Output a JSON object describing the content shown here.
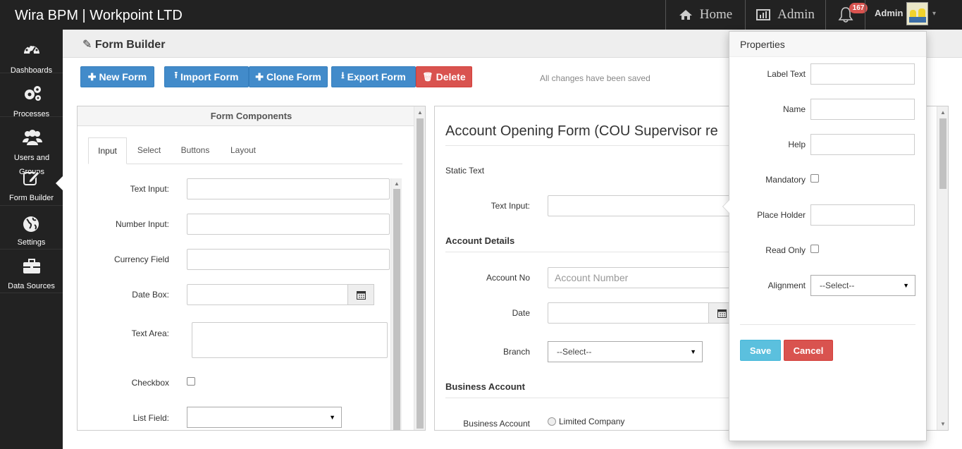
{
  "app": {
    "title": "Wira BPM | Workpoint LTD",
    "nav": {
      "home": "Home",
      "admin": "Admin",
      "notifications_count": "167",
      "user": "Admin"
    }
  },
  "sidebar": {
    "items": [
      {
        "label": "Dashboards",
        "icon": "dashboard-icon"
      },
      {
        "label": "Processes",
        "icon": "gears-icon"
      },
      {
        "label": "Users and Groups",
        "icon": "users-icon"
      },
      {
        "label": "Form Builder",
        "icon": "edit-icon"
      },
      {
        "label": "Settings",
        "icon": "globe-icon"
      },
      {
        "label": "Data Sources",
        "icon": "briefcase-icon"
      }
    ]
  },
  "page": {
    "title": "Form Builder",
    "status": "All changes have been saved"
  },
  "toolbar": {
    "new_form": "New Form",
    "import_form": "Import Form",
    "clone_form": "Clone Form",
    "export_form": "Export Form",
    "delete": "Delete"
  },
  "components_panel": {
    "title": "Form Components",
    "tabs": [
      "Input",
      "Select",
      "Buttons",
      "Layout"
    ],
    "active_tab": "Input",
    "fields": {
      "text_input": "Text Input:",
      "number_input": "Number Input:",
      "currency_field": "Currency Field",
      "date_box": "Date Box:",
      "text_area": "Text Area:",
      "checkbox": "Checkbox",
      "list_field": "List Field:"
    }
  },
  "form_canvas": {
    "title": "Account Opening Form (COU Supervisor re",
    "static_text": "Static Text",
    "text_input_label": "Text Input:",
    "section_account": "Account Details",
    "account_no_label": "Account No",
    "account_no_placeholder": "Account Number",
    "date_label": "Date",
    "branch_label": "Branch",
    "branch_value": "--Select--",
    "section_business": "Business Account",
    "business_account_label": "Business Account",
    "business_option": "Limited Company"
  },
  "properties": {
    "title": "Properties",
    "label_text": "Label Text",
    "name": "Name",
    "help": "Help",
    "mandatory": "Mandatory",
    "place_holder": "Place Holder",
    "read_only": "Read Only",
    "alignment": "Alignment",
    "alignment_value": "--Select--",
    "save": "Save",
    "cancel": "Cancel"
  },
  "colors": {
    "primary": "#428bca",
    "danger": "#d9534f",
    "info": "#5bc0de",
    "topbar": "#222222",
    "badge": "#d9534f"
  }
}
